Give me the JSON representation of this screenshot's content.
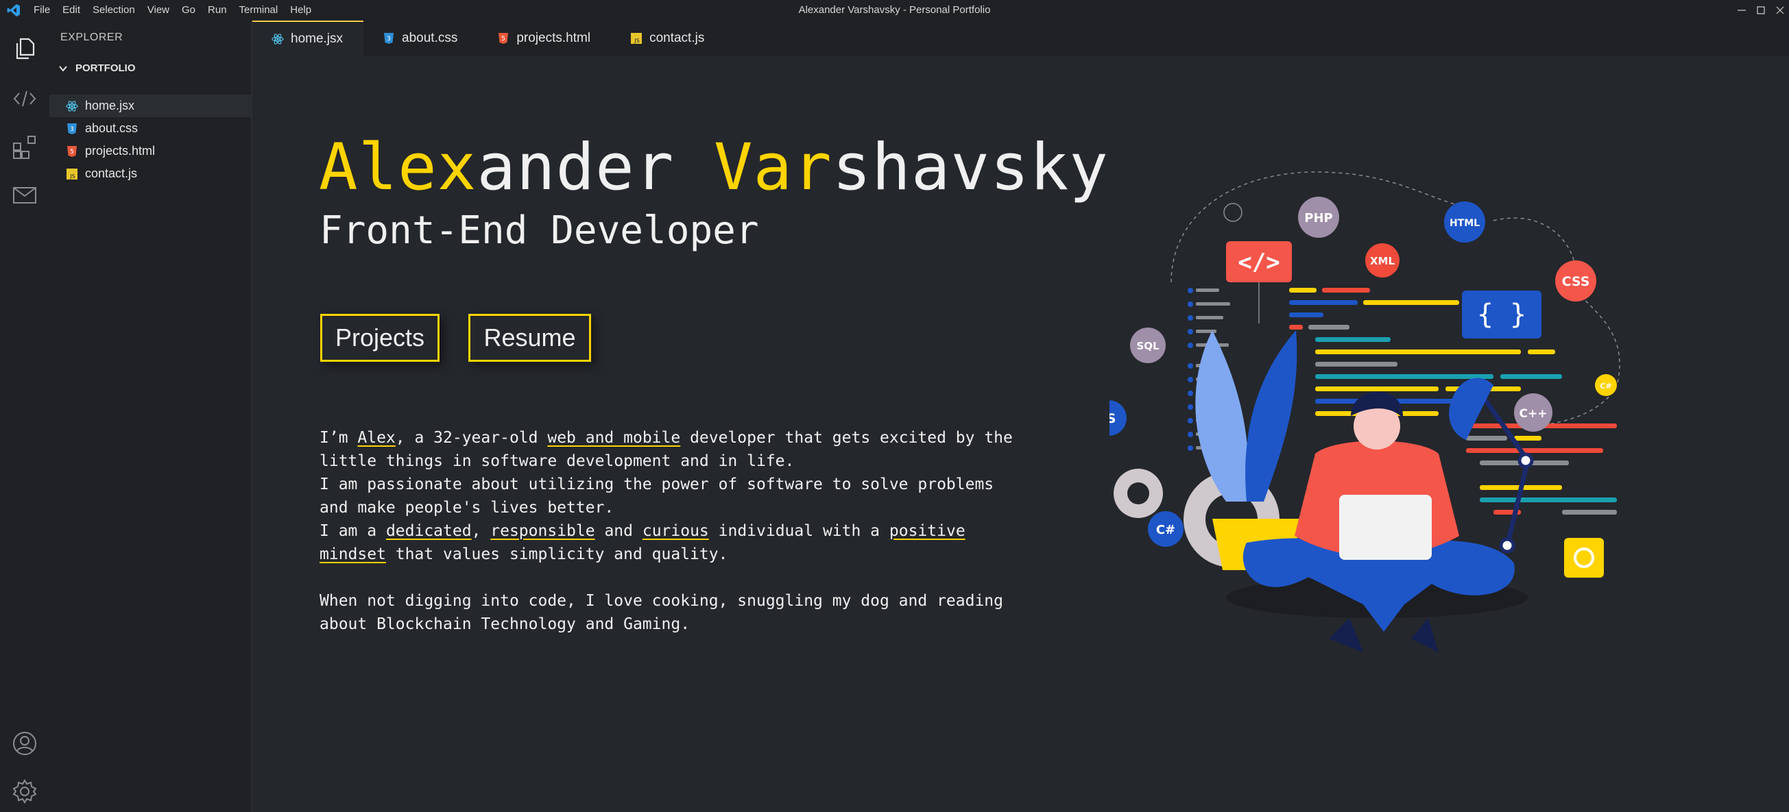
{
  "titlebar": {
    "menu": [
      "File",
      "Edit",
      "Selection",
      "View",
      "Go",
      "Run",
      "Terminal",
      "Help"
    ],
    "window_title": "Alexander Varshavsky - Personal Portfolio"
  },
  "activity_bar": {
    "items": [
      "files-icon",
      "code-icon",
      "extensions-icon",
      "mail-icon"
    ],
    "bottom": [
      "account-icon",
      "gear-icon"
    ]
  },
  "sidebar": {
    "title": "EXPLORER",
    "folder": "PORTFOLIO",
    "files": [
      {
        "name": "home.jsx",
        "icon": "react-icon"
      },
      {
        "name": "about.css",
        "icon": "css-icon"
      },
      {
        "name": "projects.html",
        "icon": "html-icon"
      },
      {
        "name": "contact.js",
        "icon": "js-icon"
      }
    ]
  },
  "tabs": [
    {
      "label": "home.jsx",
      "icon": "react-icon",
      "active": true
    },
    {
      "label": "about.css",
      "icon": "css-icon"
    },
    {
      "label": "projects.html",
      "icon": "html-icon"
    },
    {
      "label": "contact.js",
      "icon": "js-icon"
    }
  ],
  "hero": {
    "name_parts": [
      "Alex",
      "ander ",
      "Var",
      "shavsky"
    ],
    "subtitle": "Front-End Developer",
    "buttons": {
      "projects": "Projects",
      "resume": "Resume"
    }
  },
  "bio": {
    "p1": [
      "I’m ",
      "Alex",
      ", a 32-year-old ",
      "web and mobile",
      " developer that gets excited by the little things in software development and in life."
    ],
    "p2": "I am passionate about utilizing the power of software to solve problems and make people's lives better.",
    "p3": [
      "I am a ",
      "dedicated",
      ", ",
      "responsible",
      " and ",
      "curious",
      " individual with a ",
      "positive mindset",
      " that values simplicity and quality."
    ],
    "p4": "When not digging into code, I love cooking, snuggling my dog and reading about Blockchain Technology and Gaming."
  },
  "illustration": {
    "badges": [
      "PHP",
      "HTML",
      "XML",
      "CSS",
      "SQL",
      "JS",
      "C++",
      "C#",
      "C#"
    ],
    "code_tag": "</>",
    "braces": "{ }"
  },
  "colors": {
    "accent": "#ffd400",
    "background": "#24272c",
    "chrome": "#1f2125"
  }
}
